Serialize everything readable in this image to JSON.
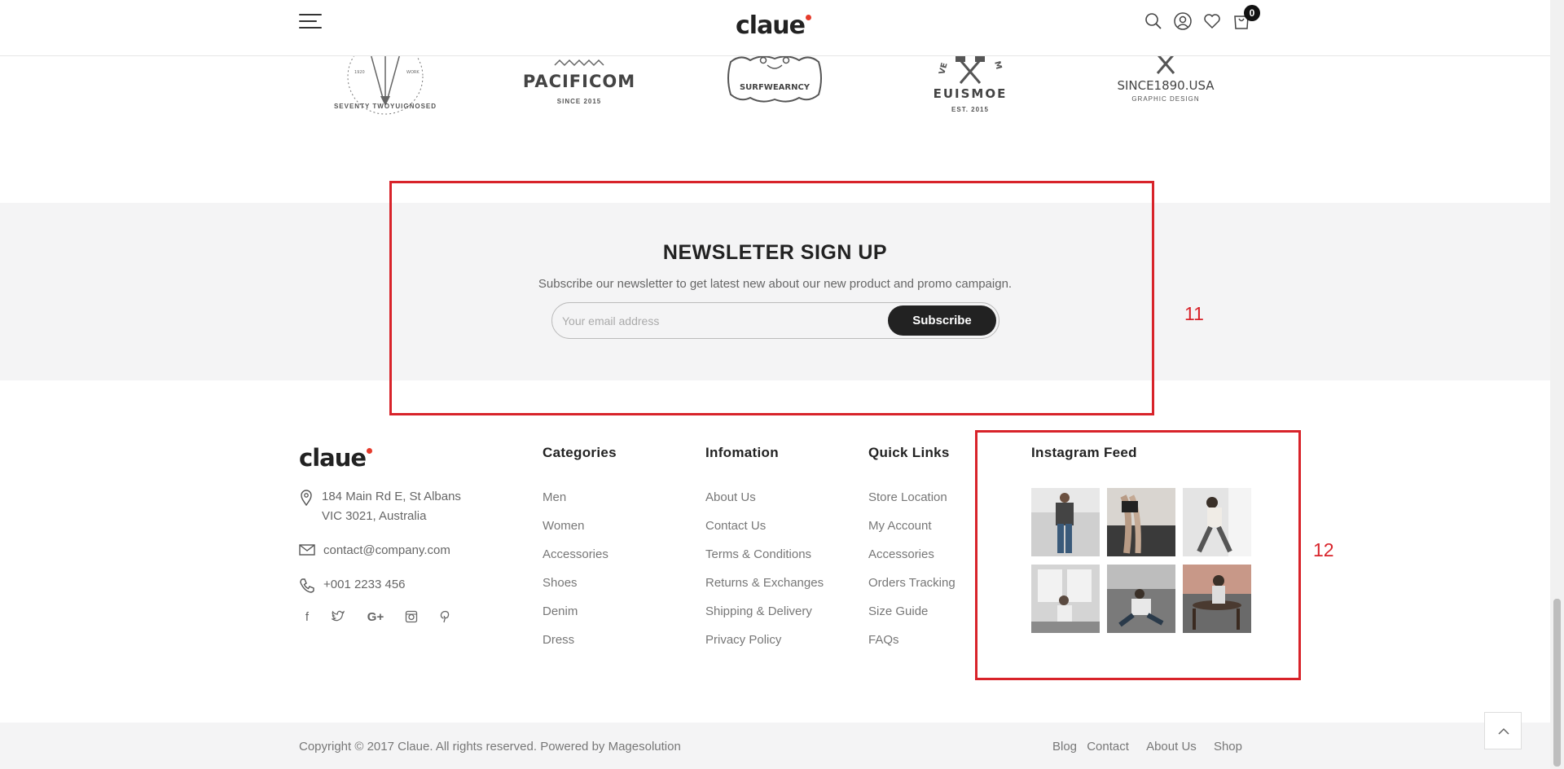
{
  "header": {
    "logo": "claue",
    "cart_count": "0",
    "icons": [
      "menu-icon",
      "search-icon",
      "user-icon",
      "heart-icon",
      "cart-icon"
    ]
  },
  "brands": [
    {
      "name": "",
      "sub": "SEVENTY TWOYUIGNOSED"
    },
    {
      "name": "PACIFICOM",
      "sub": "SINCE 2015"
    },
    {
      "name": "SURFWEARNCY",
      "sub": ""
    },
    {
      "name": "EUISMOE",
      "sub": "EST. 2015"
    },
    {
      "name": "SINCE1890.USA",
      "sub": "GRAPHIC DESIGN"
    }
  ],
  "newsletter": {
    "title": "NEWSLETER SIGN UP",
    "description": "Subscribe our newsletter to get latest new about our new product and promo campaign.",
    "placeholder": "Your email address",
    "button": "Subscribe"
  },
  "annotations": {
    "newsletter": "11",
    "instagram": "12"
  },
  "footer": {
    "logo": "claue",
    "address_line1": "184 Main Rd E, St Albans",
    "address_line2": "VIC 3021, Australia",
    "email": "contact@company.com",
    "phone": "+001 2233 456",
    "social": [
      "facebook-icon",
      "twitter-icon",
      "google-plus-icon",
      "instagram-icon",
      "pinterest-icon"
    ],
    "columns": [
      {
        "title": "Categories",
        "items": [
          "Men",
          "Women",
          "Accessories",
          "Shoes",
          "Denim",
          "Dress"
        ]
      },
      {
        "title": "Infomation",
        "items": [
          "About Us",
          "Contact Us",
          "Terms & Conditions",
          "Returns & Exchanges",
          "Shipping & Delivery",
          "Privacy Policy"
        ]
      },
      {
        "title": "Quick Links",
        "items": [
          "Store Location",
          "My Account",
          "Accessories",
          "Orders Tracking",
          "Size Guide",
          "FAQs"
        ]
      }
    ],
    "instagram_title": "Instagram Feed"
  },
  "bottom": {
    "copyright": "Copyright © 2017 Claue. All rights reserved. Powered by Magesolution",
    "links": [
      "Blog",
      "Contact",
      "About Us",
      "Shop"
    ]
  }
}
